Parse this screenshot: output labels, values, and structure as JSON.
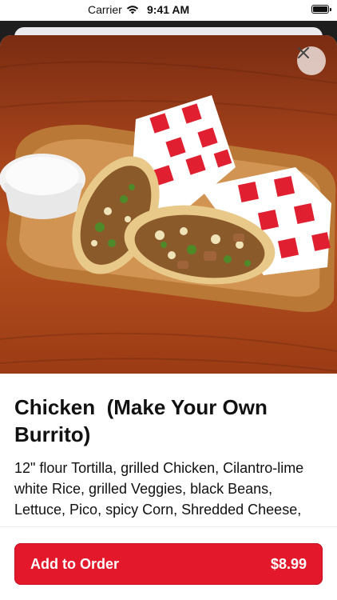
{
  "status_bar": {
    "carrier": "Carrier",
    "time": "9:41 AM"
  },
  "item": {
    "title": "Chicken  (Make Your Own Burrito)",
    "description": "12\" flour Tortilla, grilled Chicken, Cilantro-lime white Rice, grilled Veggies, black Beans, Lettuce, Pico, spicy Corn, Shredded Cheese, mild Salsa & Sour Cream",
    "image_icon": "burrito-photo"
  },
  "actions": {
    "close_icon": "close-icon",
    "add_label": "Add to Order",
    "price": "$8.99"
  },
  "colors": {
    "accent": "#e3182b",
    "text": "#111111",
    "background": "#ffffff"
  }
}
